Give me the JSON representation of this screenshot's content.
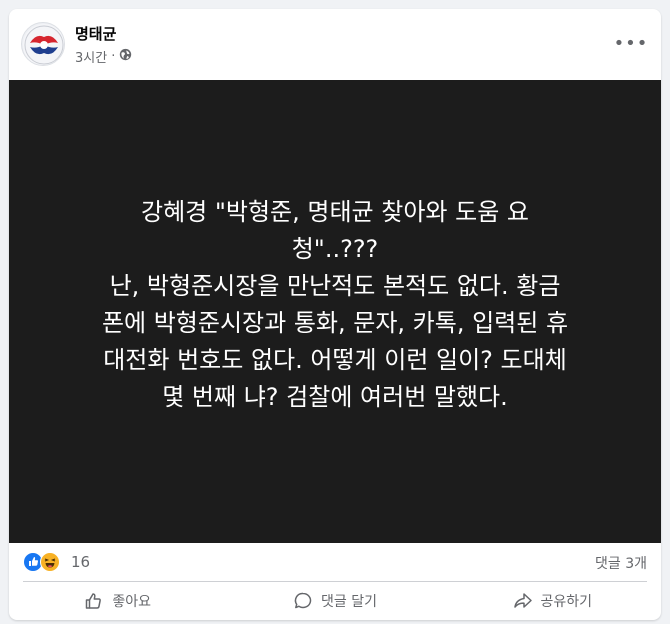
{
  "post": {
    "author": "명태균",
    "time": "3시간",
    "separator": "·",
    "more_label": "•••",
    "image_text": {
      "lines": [
        "강혜경 \"박형준, 명태균 찾아와 도움 요",
        "청\"..???",
        "난, 박형준시장을 만난적도 본적도 없다. 황금",
        "폰에 박형준시장과 통화, 문자, 카톡, 입력된 휴",
        "대전화 번호도 없다. 어떻게 이런 일이? 도대체",
        "몇 번째 냐? 검찰에 여러번 말했다."
      ]
    }
  },
  "reactions": {
    "count": "16",
    "comments": "댓글 3개",
    "types": [
      "like",
      "haha"
    ]
  },
  "actions": {
    "like_label": "좋아요",
    "comment_label": "댓글 달기",
    "share_label": "공유하기"
  },
  "colors": {
    "like_blue": "#1877f2",
    "haha_yellow": "#f7b125",
    "image_bg": "#1c1c1c",
    "meta_gray": "#65676b"
  }
}
